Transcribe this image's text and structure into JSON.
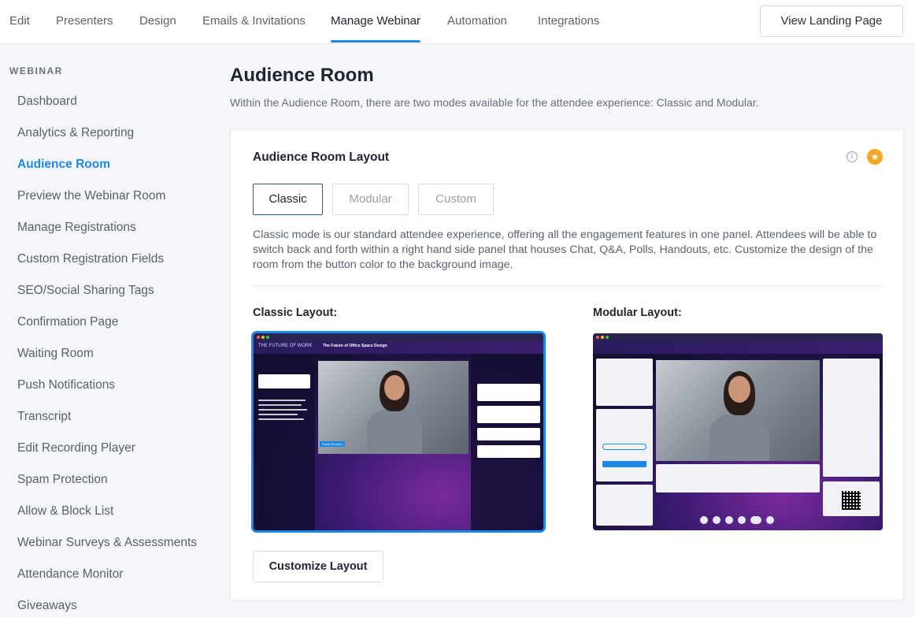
{
  "top_nav": {
    "tabs": [
      {
        "label": "Edit"
      },
      {
        "label": "Presenters"
      },
      {
        "label": "Design"
      },
      {
        "label": "Emails & Invitations"
      },
      {
        "label": "Manage Webinar"
      },
      {
        "label": "Automation"
      },
      {
        "label": "Integrations"
      }
    ],
    "active_tab": "Manage Webinar",
    "view_landing_label": "View Landing Page"
  },
  "sidebar": {
    "heading": "WEBINAR",
    "items": [
      {
        "label": "Dashboard"
      },
      {
        "label": "Analytics & Reporting"
      },
      {
        "label": "Audience Room"
      },
      {
        "label": "Preview the Webinar Room"
      },
      {
        "label": "Manage Registrations"
      },
      {
        "label": "Custom Registration Fields"
      },
      {
        "label": "SEO/Social Sharing Tags"
      },
      {
        "label": "Confirmation Page"
      },
      {
        "label": "Waiting Room"
      },
      {
        "label": "Push Notifications"
      },
      {
        "label": "Transcript"
      },
      {
        "label": "Edit Recording Player"
      },
      {
        "label": "Spam Protection"
      },
      {
        "label": "Allow & Block List"
      },
      {
        "label": "Webinar Surveys & Assessments"
      },
      {
        "label": "Attendance Monitor"
      },
      {
        "label": "Giveaways"
      }
    ],
    "active_item": "Audience Room"
  },
  "main": {
    "title": "Audience Room",
    "subtitle": "Within the Audience Room, there are two modes available for the attendee experience: Classic and Modular.",
    "card": {
      "title": "Audience Room Layout",
      "modes": [
        {
          "label": "Classic"
        },
        {
          "label": "Modular"
        },
        {
          "label": "Custom"
        }
      ],
      "active_mode": "Classic",
      "description": "Classic mode is our standard attendee experience, offering all the engagement features in one panel. Attendees will be able to switch back and forth within a right hand side panel that houses Chat, Q&A, Polls, Handouts, etc. Customize the design of the room from the button color to the background image.",
      "classic_label": "Classic Layout:",
      "modular_label": "Modular Layout:",
      "customize_label": "Customize Layout",
      "preview": {
        "brand": "THE FUTURE OF WORK",
        "session_title": "The Future of Office Space Design",
        "presenter_name": "Paula Romero",
        "presenter_role": "Chief Research Officer"
      }
    }
  },
  "colors": {
    "accent": "#1e88e5",
    "star": "#f5a623",
    "active_mode_border": "#2a5d8f"
  }
}
